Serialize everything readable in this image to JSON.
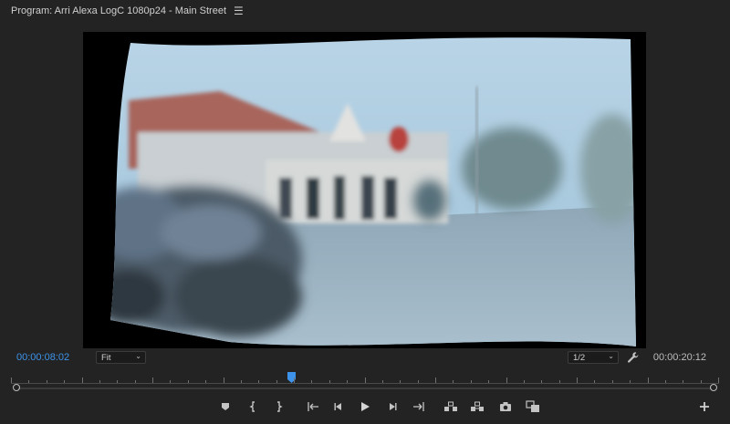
{
  "header": {
    "title": "Program: Arri Alexa LogC 1080p24 - Main Street",
    "menu_icon": "hamburger-menu-icon"
  },
  "viewer": {
    "content": "video-frame"
  },
  "controls": {
    "current_timecode": "00:00:08:02",
    "duration_timecode": "00:00:20:12",
    "zoom_select": "Fit",
    "resolution_select": "1/2",
    "settings_icon": "wrench-icon"
  },
  "timeline": {
    "playhead_fraction": 0.395
  },
  "transport": {
    "buttons": [
      {
        "name": "add-marker",
        "icon": "marker-icon"
      },
      {
        "name": "mark-in",
        "icon": "mark-in-icon"
      },
      {
        "name": "mark-out",
        "icon": "mark-out-icon"
      },
      {
        "name": "go-to-in",
        "icon": "go-to-in-icon"
      },
      {
        "name": "step-back",
        "icon": "step-back-icon"
      },
      {
        "name": "play",
        "icon": "play-icon"
      },
      {
        "name": "step-forward",
        "icon": "step-forward-icon"
      },
      {
        "name": "go-to-out",
        "icon": "go-to-out-icon"
      },
      {
        "name": "lift",
        "icon": "lift-icon"
      },
      {
        "name": "extract",
        "icon": "extract-icon"
      },
      {
        "name": "export-frame",
        "icon": "camera-icon"
      },
      {
        "name": "comparison-view",
        "icon": "comparison-icon"
      },
      {
        "name": "button-editor",
        "icon": "plus-icon"
      }
    ]
  },
  "colors": {
    "accent": "#3d93ea",
    "panel_bg": "#232323",
    "text": "#bdbdbd"
  }
}
